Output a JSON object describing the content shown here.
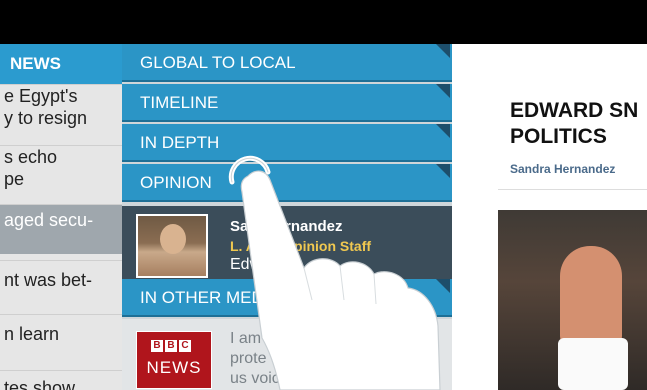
{
  "left_list": {
    "header": "NEWS",
    "items": [
      {
        "lines": [
          "e Egypt's",
          "y to resign"
        ]
      },
      {
        "lines": [
          "s echo",
          "pe"
        ]
      },
      {
        "lines": [
          "aged secu-"
        ]
      },
      {
        "lines": [
          "nt was bet-"
        ]
      },
      {
        "lines": [
          "n learn"
        ]
      },
      {
        "lines": [
          "tes show"
        ]
      }
    ]
  },
  "menu": {
    "rows": [
      "GLOBAL TO LOCAL",
      "TIMELINE",
      "IN DEPTH",
      "OPINION"
    ],
    "author": {
      "name": "Sandra Hernandez",
      "name_visible": "Sa    o Hernandez",
      "staff_visible": "L. A.    es Opinion Staff",
      "snippet_visible": "Edwa      den, a"
    },
    "other_media_label": "IN OTHER MEDIA",
    "other_media_story": {
      "logo_blocks": [
        "B",
        "B",
        "C"
      ],
      "logo_text": "NEWS",
      "snippet_visible": "I am\nprote\nus voic"
    }
  },
  "article": {
    "headline": "EDWARD SN\nPOLITICS",
    "byline": "Sandra Hernandez"
  },
  "colors": {
    "accent_blue": "#2b95c6",
    "dark_blue": "#1d6f96",
    "staff_gold": "#f0c850",
    "bbc_red": "#b0151c"
  },
  "icons": {
    "gesture": "tap-finger-icon",
    "corner": "corner-triangle-icon"
  }
}
